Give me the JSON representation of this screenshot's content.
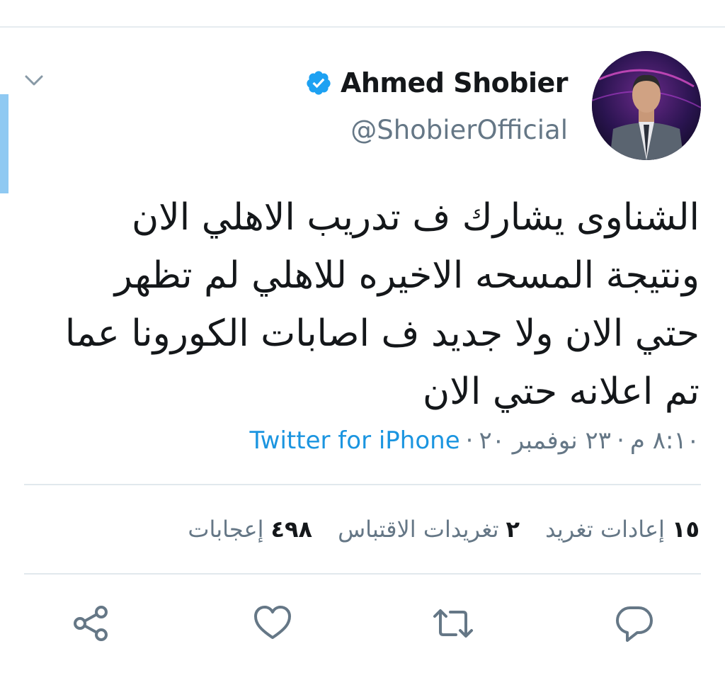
{
  "author": {
    "display_name": "Ahmed Shobier",
    "handle": "@ShobierOfficial"
  },
  "tweet": {
    "lines": [
      "الشناوى يشارك ف تدريب الاهلي الان",
      "ونتيجة المسحه الاخيره للاهلي لم تظهر",
      "حتي الان ولا جديد ف اصابات الكورونا عما",
      "تم اعلانه حتي الان"
    ],
    "time": "٨:١٠ م",
    "date": "٢٣ نوفمبر ٢٠",
    "separator": "·",
    "source": "Twitter for iPhone"
  },
  "stats": {
    "retweets": {
      "count": "١٥",
      "label": "إعادات تغريد"
    },
    "quote_tweets": {
      "count": "٢",
      "label": "تغريدات الاقتباس"
    },
    "likes": {
      "count": "٤٩٨",
      "label": "إعجابات"
    }
  },
  "icons": {
    "caret": "chevron-down-icon",
    "verified": "verified-badge-icon",
    "reply": "reply-icon",
    "retweet": "retweet-icon",
    "like": "like-icon",
    "share": "share-icon"
  },
  "colors": {
    "verified": "#1da1f2",
    "source_link": "#1b95e0",
    "secondary_text": "#657786",
    "action_icons": "#657786",
    "left_accent": "#8fc9f2"
  }
}
